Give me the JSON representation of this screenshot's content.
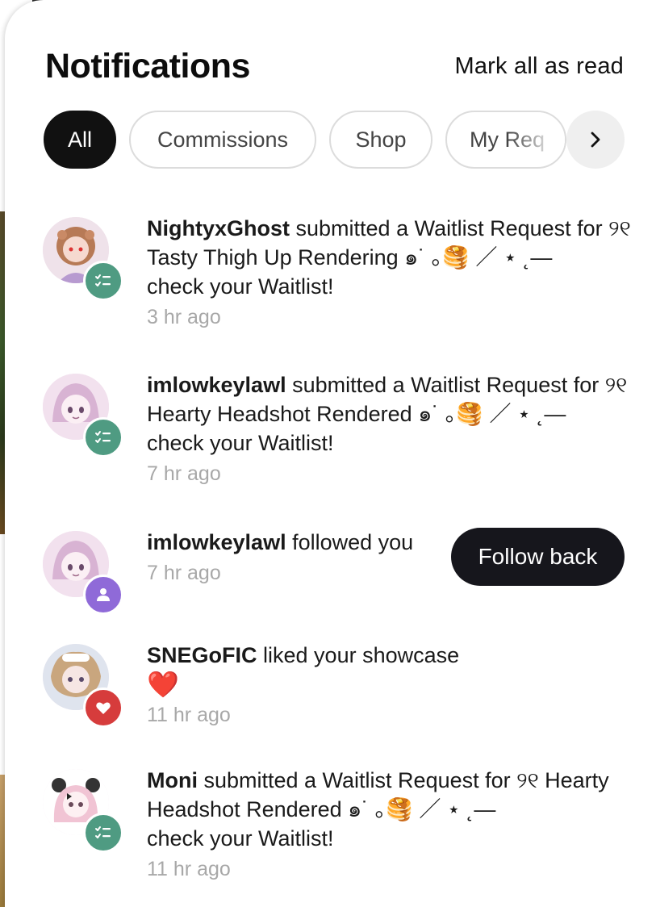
{
  "header": {
    "title": "Notifications",
    "mark_all": "Mark all as read"
  },
  "filters": [
    {
      "label": "All",
      "active": true
    },
    {
      "label": "Commissions",
      "active": false
    },
    {
      "label": "Shop",
      "active": false
    },
    {
      "label": "My Req",
      "active": false
    }
  ],
  "colors": {
    "waitlist_badge": "#4f9b82",
    "follow_badge": "#8f6ad8",
    "like_badge": "#d63c3c",
    "primary_button": "#16161c"
  },
  "notifications": [
    {
      "user": "NightyxGhost",
      "action": " submitted a Waitlist Request for ୨୧ Tasty Thigh Up Rendering ๑˙ ｡🥞 ／ ⋆ ˛—",
      "line2": "check your Waitlist!",
      "time": "3 hr ago",
      "badge_icon": "checklist-icon"
    },
    {
      "user": "imlowkeylawl",
      "action": " submitted a Waitlist Request for ୨୧ Hearty Headshot Rendered ๑˙ ｡🥞 ／ ⋆ ˛—",
      "line2": "check your Waitlist!",
      "time": "7 hr ago",
      "badge_icon": "checklist-icon"
    },
    {
      "user": "imlowkeylawl",
      "action": " followed you",
      "time": "7 hr ago",
      "badge_icon": "person-icon",
      "button": "Follow back"
    },
    {
      "user": "SNEGoFIC",
      "action": " liked your showcase",
      "emoji": "❤️",
      "time": "11 hr ago",
      "badge_icon": "heart-icon"
    },
    {
      "user": "Moni",
      "action": " submitted a Waitlist Request for ୨୧ Hearty Headshot Rendered ๑˙ ｡🥞 ／ ⋆ ˛—",
      "line2": "check your Waitlist!",
      "time": "11 hr ago",
      "badge_icon": "checklist-icon"
    }
  ]
}
